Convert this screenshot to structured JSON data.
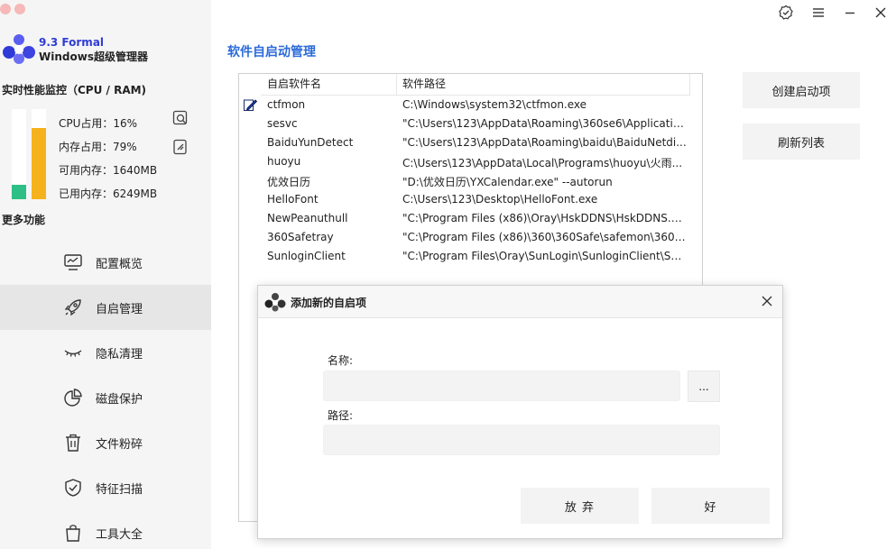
{
  "app": {
    "name": "9.3 Formal",
    "subtitle": "Windows超级管理器"
  },
  "perf": {
    "title": "实时性能监控（CPU / RAM)",
    "cpu_percent": 16,
    "mem_percent": 79,
    "cpu_label": "CPU占用：16%",
    "mem_label": "内存占用：79%",
    "avail_label": "可用内存：1640MB",
    "used_label": "已用内存：6249MB"
  },
  "more_title": "更多功能",
  "nav": [
    {
      "label": "配置概览",
      "icon": "monitor-icon"
    },
    {
      "label": "自启管理",
      "icon": "rocket-icon",
      "active": true
    },
    {
      "label": "隐私清理",
      "icon": "eye-closed-icon"
    },
    {
      "label": "磁盘保护",
      "icon": "pie-chart-icon"
    },
    {
      "label": "文件粉碎",
      "icon": "trash-icon"
    },
    {
      "label": "特征扫描",
      "icon": "shield-icon"
    },
    {
      "label": "工具大全",
      "icon": "bag-icon"
    }
  ],
  "main": {
    "title": "软件自启动管理",
    "columns": [
      "自启软件名",
      "软件路径"
    ],
    "rows": [
      {
        "name": "ctfmon",
        "path": "C:\\Windows\\system32\\ctfmon.exe"
      },
      {
        "name": "sesvc",
        "path": "\"C:\\Users\\123\\AppData\\Roaming\\360se6\\Applicatio..."
      },
      {
        "name": "BaiduYunDetect",
        "path": "\"C:\\Users\\123\\AppData\\Roaming\\baidu\\BaiduNetdi..."
      },
      {
        "name": "huoyu",
        "path": "C:\\Users\\123\\AppData\\Local\\Programs\\huoyu\\火雨..."
      },
      {
        "name": "优效日历",
        "path": "\"D:\\优效日历\\YXCalendar.exe\" --autorun"
      },
      {
        "name": "HelloFont",
        "path": "C:\\Users\\123\\Desktop\\HelloFont.exe"
      },
      {
        "name": "NewPeanuthull",
        "path": "\"C:\\Program Files (x86)\\Oray\\HskDDNS\\HskDDNS.e..."
      },
      {
        "name": "360Safetray",
        "path": "\"C:\\Program Files (x86)\\360\\360Safe\\safemon\\360tr..."
      },
      {
        "name": "SunloginClient",
        "path": "\"C:\\Program Files\\Oray\\SunLogin\\SunloginClient\\Su..."
      }
    ],
    "buttons": {
      "create": "创建启动项",
      "refresh": "刷新列表"
    }
  },
  "dialog": {
    "title": "添加新的自启项",
    "name_label": "名称:",
    "path_label": "路径:",
    "name_value": "",
    "path_value": "",
    "browse_label": "...",
    "cancel_label": "放 弃",
    "ok_label": "好"
  },
  "colors": {
    "accent": "#2b6ad9",
    "brand": "#2f3bd6",
    "cpu_bar": "#2ebf86",
    "mem_bar": "#f5b21c"
  }
}
